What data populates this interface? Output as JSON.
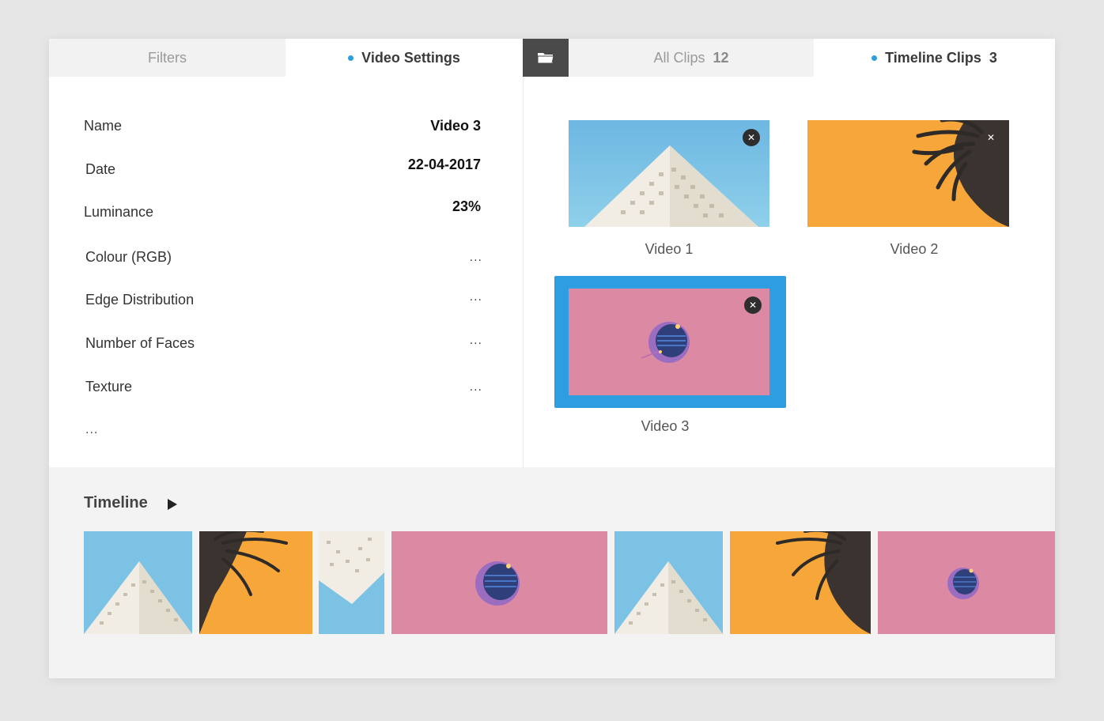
{
  "tabs": {
    "filters": {
      "label": "Filters"
    },
    "video_settings": {
      "label": "Video Settings"
    },
    "all_clips": {
      "label": "All Clips",
      "count": "12"
    },
    "timeline_clips": {
      "label": "Timeline Clips",
      "count": "3"
    }
  },
  "folder_icon": "folder-icon",
  "settings": {
    "name_label": "Name",
    "name_value": "Video 3",
    "date_label": "Date",
    "date_value": "22-04-2017",
    "luminance_label": "Luminance",
    "luminance_value": "23%",
    "colour_label": "Colour (RGB)",
    "colour_value": "...",
    "edge_label": "Edge Distribution",
    "edge_value": "...",
    "faces_label": "Number of Faces",
    "faces_value": "...",
    "texture_label": "Texture",
    "texture_value": "...",
    "more": "..."
  },
  "clips": [
    {
      "label": "Video 1",
      "scene": "building"
    },
    {
      "label": "Video 2",
      "scene": "pineapple"
    },
    {
      "label": "Video 3",
      "scene": "pink",
      "selected": true
    }
  ],
  "close_icon": "close-icon",
  "timeline": {
    "title": "Timeline",
    "play_icon": "play-icon"
  },
  "colors": {
    "accent": "#2f9fdc",
    "sky": "#7cc2e4",
    "orange": "#f7a63a",
    "pink": "#dd8aa3",
    "dark_tab": "#4a4a4a"
  }
}
